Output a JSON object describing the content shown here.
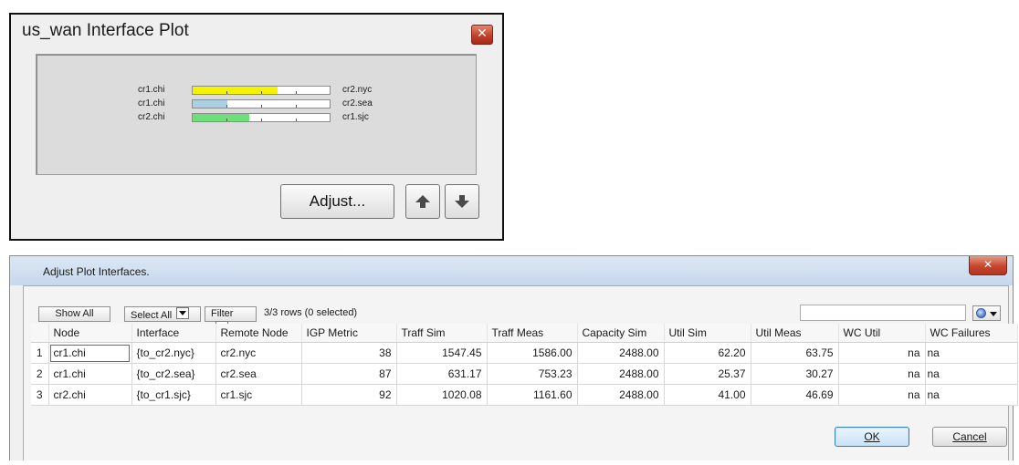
{
  "plot_window": {
    "title": "us_wan Interface Plot",
    "close_glyph": "✕",
    "rows": [
      {
        "left_label": "cr1.chi",
        "right_label": "cr2.nyc",
        "fill_percent": 62.2,
        "color": "#f5f200"
      },
      {
        "left_label": "cr1.chi",
        "right_label": "cr2.sea",
        "fill_percent": 25.37,
        "color": "#a9d0e4"
      },
      {
        "left_label": "cr2.chi",
        "right_label": "cr1.sjc",
        "fill_percent": 41.0,
        "color": "#6ee07a"
      }
    ],
    "adjust_label": "Adjust...",
    "up_icon": "arrow-up-icon",
    "down_icon": "arrow-down-icon"
  },
  "adjust_dialog": {
    "title": "Adjust Plot Interfaces.",
    "close_glyph": "✕",
    "toolbar": {
      "show_all_label": "Show All",
      "select_all_label": "Select All",
      "filter_label": "Filter",
      "row_count": "3/3 rows (0 selected)",
      "search_value": "",
      "options_icon": "gear-icon"
    },
    "columns": [
      "",
      "Node",
      "Interface",
      "Remote Node",
      "IGP Metric",
      "Traff Sim",
      "Traff Meas",
      "Capacity Sim",
      "Util Sim",
      "Util Meas",
      "WC Util",
      "WC Failures"
    ],
    "rows": [
      [
        "1",
        "cr1.chi",
        "{to_cr2.nyc}",
        "cr2.nyc",
        "38",
        "1547.45",
        "1586.00",
        "2488.00",
        "62.20",
        "63.75",
        "na",
        "na"
      ],
      [
        "2",
        "cr1.chi",
        "{to_cr2.sea}",
        "cr2.sea",
        "87",
        "631.17",
        "753.23",
        "2488.00",
        "25.37",
        "30.27",
        "na",
        "na"
      ],
      [
        "3",
        "cr2.chi",
        "{to_cr1.sjc}",
        "cr1.sjc",
        "92",
        "1020.08",
        "1161.60",
        "2488.00",
        "41.00",
        "46.69",
        "na",
        "na"
      ]
    ],
    "ok_label": "OK",
    "cancel_label": "Cancel"
  }
}
